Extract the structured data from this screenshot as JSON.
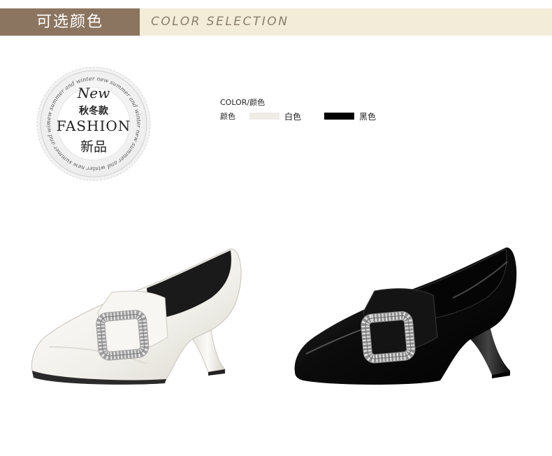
{
  "header": {
    "title_cn": "可选颜色",
    "title_en": "COLOR SELECTION"
  },
  "badge": {
    "new": "New",
    "season": "秋冬款",
    "fashion": "FASHION",
    "new_cn": "新品",
    "ring_text": "new summer and winter new summer and winter new summer and winter new summer and winter"
  },
  "color_info": {
    "title": "COLOR/颜色",
    "row_label": "颜色",
    "options": [
      {
        "name": "白色",
        "color": "#efece6"
      },
      {
        "name": "黑色",
        "color": "#000000"
      }
    ]
  },
  "colors": {
    "header_dark": "#8c7560",
    "header_light": "#f3ecd8"
  }
}
